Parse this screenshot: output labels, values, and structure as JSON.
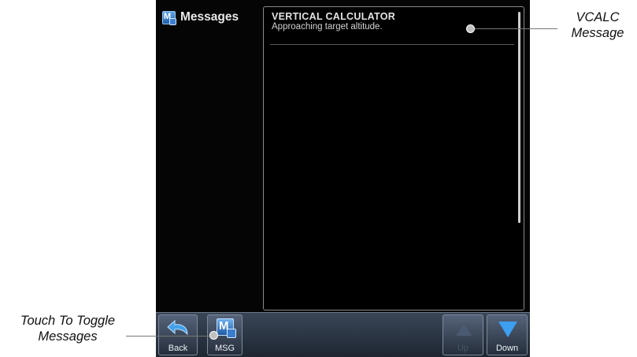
{
  "header": {
    "title": "Messages",
    "icon": "messages-icon"
  },
  "messages": [
    {
      "title": "VERTICAL CALCULATOR",
      "body": "Approaching target altitude."
    }
  ],
  "softkeys": {
    "back": "Back",
    "msg": "MSG",
    "up": "Up",
    "down": "Down"
  },
  "callouts": {
    "vcalc_line1": "VCALC",
    "vcalc_line2": "Message",
    "toggle_line1": "Touch To Toggle",
    "toggle_line2": "Messages"
  },
  "colors": {
    "accent": "#3d9ff0",
    "background": "#050505"
  }
}
